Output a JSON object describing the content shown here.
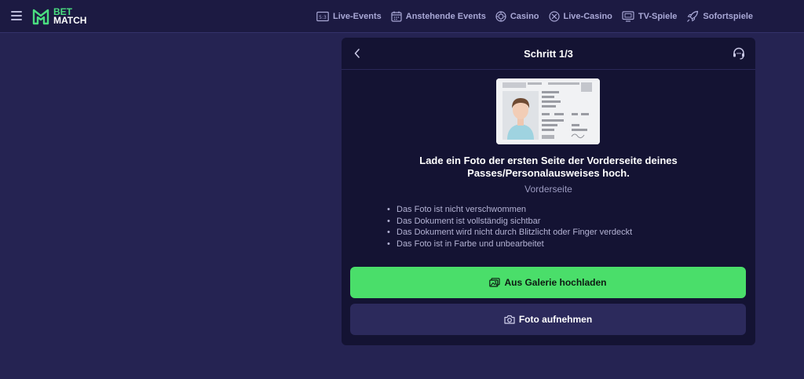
{
  "header": {
    "logo_line1": "BET",
    "logo_line2": "MATCH",
    "nav": [
      {
        "label": "Live-Events",
        "icon": "scoreboard-icon"
      },
      {
        "label": "Anstehende Events",
        "icon": "calendar-icon"
      },
      {
        "label": "Casino",
        "icon": "casino-chip-icon"
      },
      {
        "label": "Live-Casino",
        "icon": "live-casino-chip-icon"
      },
      {
        "label": "TV-Spiele",
        "icon": "tv-icon"
      },
      {
        "label": "Sofortspiele",
        "icon": "rocket-icon"
      }
    ]
  },
  "panel": {
    "title": "Schritt 1/3",
    "headline": "Lade ein Foto der ersten Seite der Vorderseite deines Passes/Personalausweises hoch.",
    "side_label": "Vorderseite",
    "requirements": [
      "Das Foto ist nicht verschwommen",
      "Das Dokument ist vollständig sichtbar",
      "Das Dokument wird nicht durch Blitzlicht oder Finger verdeckt",
      "Das Foto ist in Farbe und unbearbeitet"
    ],
    "gallery_button": "Aus Galerie hochladen",
    "photo_button": "Foto aufnehmen"
  },
  "colors": {
    "background": "#252352",
    "header": "#1c1a42",
    "panel": "#141333",
    "accent_green": "#4ade6a",
    "secondary_button": "#2c2a5c"
  }
}
